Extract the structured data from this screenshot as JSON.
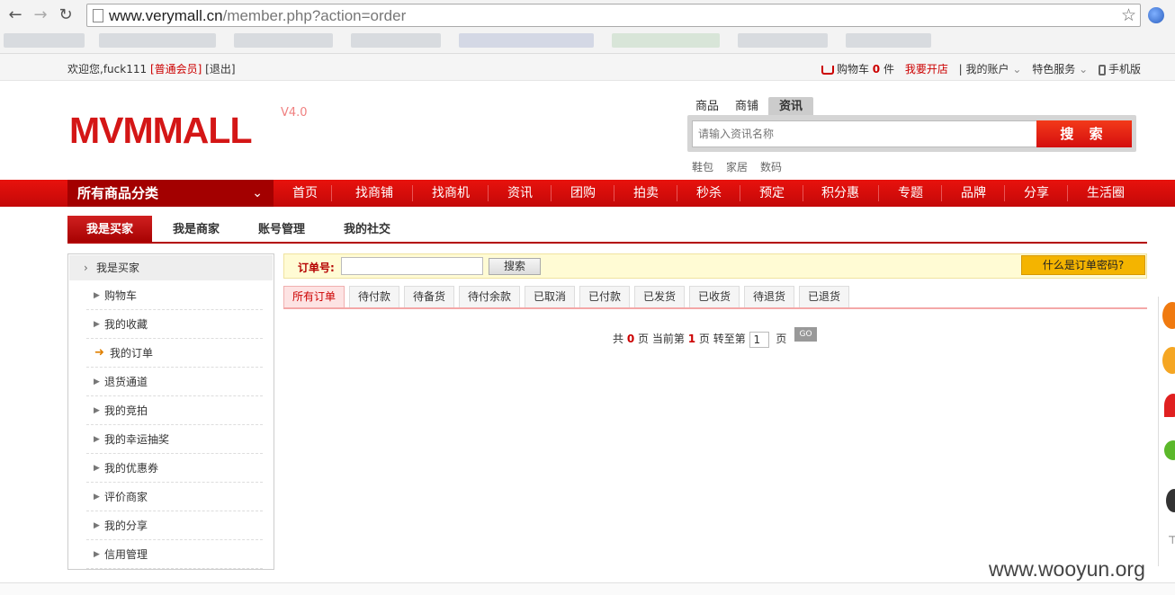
{
  "browser": {
    "url_host": "www.verymall.cn",
    "url_path": "/member.php?action=order"
  },
  "topbar": {
    "welcome": "欢迎您,fuck111",
    "member_level": "[普通会员]",
    "logout": "[退出]",
    "cart_label": "购物车",
    "cart_count": "0",
    "cart_unit": "件",
    "open_shop": "我要开店",
    "my_account": "我的账户",
    "special_service": "特色服务",
    "mobile": "手机版"
  },
  "header": {
    "logo": "MVMMALL",
    "version": "V4.0",
    "search_tabs": [
      "商品",
      "商铺",
      "资讯"
    ],
    "search_placeholder": "请输入资讯名称",
    "search_button": "搜 索",
    "hot_words": [
      "鞋包",
      "家居",
      "数码"
    ]
  },
  "nav": {
    "all_categories": "所有商品分类",
    "items": [
      "首页",
      "找商铺",
      "找商机",
      "资讯",
      "团购",
      "拍卖",
      "秒杀",
      "预定",
      "积分惠",
      "专题",
      "品牌",
      "分享",
      "生活圈"
    ]
  },
  "member_tabs": [
    "我是买家",
    "我是商家",
    "账号管理",
    "我的社交"
  ],
  "sidebar": {
    "head": "我是买家",
    "items": [
      "购物车",
      "我的收藏",
      "我的订单",
      "退货通道",
      "我的竞拍",
      "我的幸运抽奖",
      "我的优惠券",
      "评价商家",
      "我的分享",
      "信用管理"
    ]
  },
  "order_search": {
    "label": "订单号:",
    "button": "搜索",
    "help": "什么是订单密码?"
  },
  "order_tabs": [
    "所有订单",
    "待付款",
    "待备货",
    "待付余款",
    "已取消",
    "已付款",
    "已发货",
    "已收货",
    "待退货",
    "已退货"
  ],
  "pager": {
    "prefix": "共",
    "total": "0",
    "page_word": "页 当前第",
    "current": "1",
    "goto": "页 转至第",
    "input": "1",
    "suffix": "页",
    "go": "GO"
  },
  "watermark": "www.wooyun.org"
}
